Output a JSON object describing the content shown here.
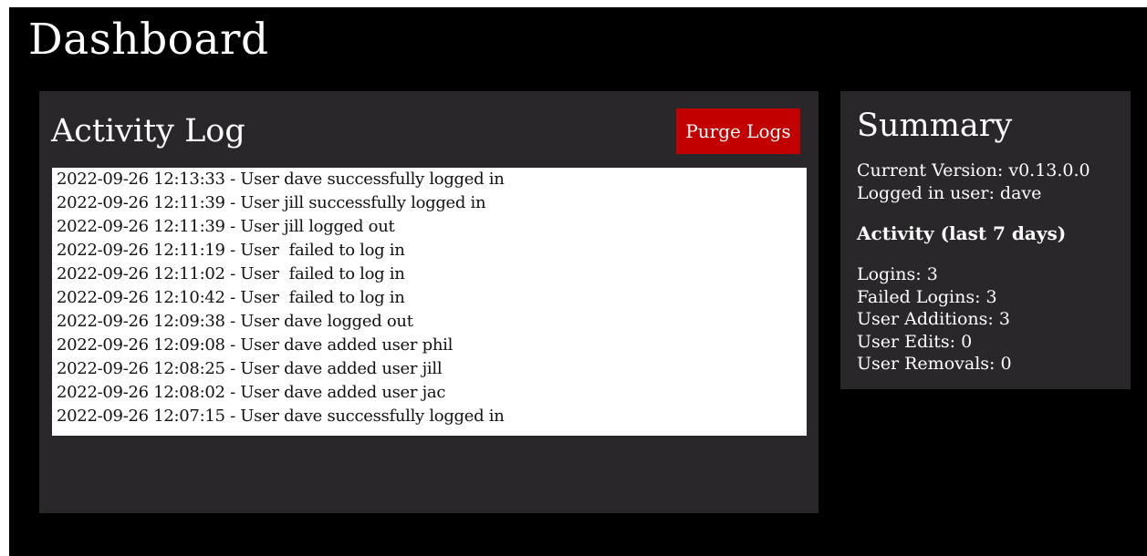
{
  "page_title": "Dashboard",
  "activity_log": {
    "title": "Activity Log",
    "purge_button_label": "Purge Logs",
    "entries": [
      "2022-09-26 12:13:33 - User dave successfully logged in",
      "2022-09-26 12:11:39 - User jill successfully logged in",
      "2022-09-26 12:11:39 - User jill logged out",
      "2022-09-26 12:11:19 - User  failed to log in",
      "2022-09-26 12:11:02 - User  failed to log in",
      "2022-09-26 12:10:42 - User  failed to log in",
      "2022-09-26 12:09:38 - User dave logged out",
      "2022-09-26 12:09:08 - User dave added user phil",
      "2022-09-26 12:08:25 - User dave added user jill",
      "2022-09-26 12:08:02 - User dave added user jac",
      "2022-09-26 12:07:15 - User dave successfully logged in"
    ]
  },
  "summary": {
    "title": "Summary",
    "current_version": "Current Version: v0.13.0.0",
    "logged_in_user": "Logged in user: dave",
    "activity_heading": "Activity (last 7 days)",
    "stats": {
      "logins": "Logins: 3",
      "failed_logins": "Failed Logins: 3",
      "user_additions": "User Additions: 3",
      "user_edits": "User Edits: 0",
      "user_removals": "User Removals: 0"
    }
  },
  "colors": {
    "background": "#000000",
    "panel": "#2a272a",
    "purge_button": "#c20000",
    "log_box": "#ffffff"
  }
}
